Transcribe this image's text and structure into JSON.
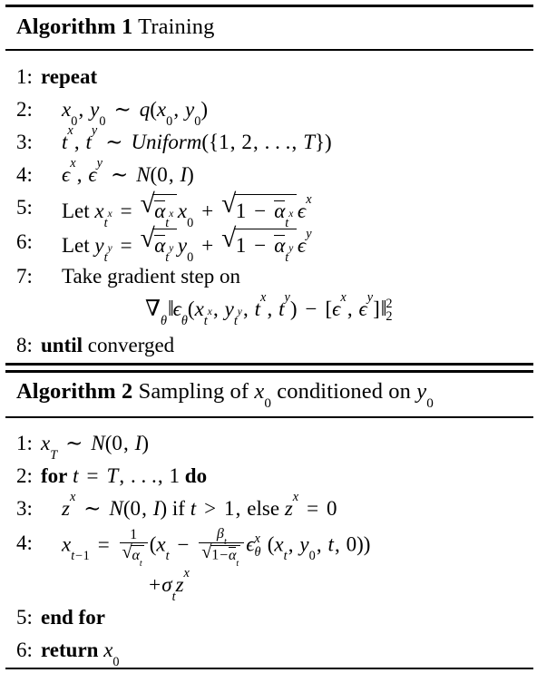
{
  "document": {
    "type": "algorithm-pseudocode-figure",
    "background_color": "#ffffff",
    "text_color": "#000000"
  },
  "algorithms": [
    {
      "id": "algorithm-1",
      "title_keyword": "Algorithm 1",
      "title_caption": "Training",
      "lines": [
        {
          "number": "1:",
          "indent": 0,
          "text": "repeat",
          "style": "keyword"
        },
        {
          "number": "2:",
          "indent": 1,
          "text": "x₀, y₀ ~ q(x₀, y₀)",
          "style": "math"
        },
        {
          "number": "3:",
          "indent": 1,
          "text": "t^x, t^y ~ Uniform({1, 2, …, T})",
          "style": "math"
        },
        {
          "number": "4:",
          "indent": 1,
          "text": "ϵ^x, ϵ^y ~ N(0, I)",
          "style": "math"
        },
        {
          "number": "5:",
          "indent": 1,
          "text": "Let x_{t^x} = √(ᾱ_{t^x}) x₀ + √(1 − ᾱ_{t^x}) ϵ^x",
          "style": "math"
        },
        {
          "number": "6:",
          "indent": 1,
          "text": "Let y_{t^y} = √(ᾱ_{t^y}) y₀ + √(1 − ᾱ_{t^y}) ϵ^y",
          "style": "math"
        },
        {
          "number": "7:",
          "indent": 1,
          "text": "Take gradient step on",
          "style": "text"
        },
        {
          "number": "",
          "indent": 2,
          "text": "∇_θ ‖ ϵ_θ(x_{t^x}, y_{t^y}, t^x, t^y) − [ϵ^x, ϵ^y] ‖²₂",
          "style": "math"
        },
        {
          "number": "8:",
          "indent": 0,
          "text": "until converged",
          "style": "keyword"
        }
      ]
    },
    {
      "id": "algorithm-2",
      "title_keyword": "Algorithm 2",
      "title_caption": "Sampling of x₀ conditioned on y₀",
      "lines": [
        {
          "number": "1:",
          "indent": 0,
          "text": "x_T ~ N(0, I)",
          "style": "math"
        },
        {
          "number": "2:",
          "indent": 0,
          "text": "for t = T, …, 1 do",
          "style": "keyword"
        },
        {
          "number": "3:",
          "indent": 1,
          "text": "z^x ~ N(0, I) if t > 1, else z^x = 0",
          "style": "math"
        },
        {
          "number": "4:",
          "indent": 1,
          "text": "x_{t−1} = 1/√(α_t) (x_t − β_t/√(1−ᾱ_t) ϵ^x_θ(x_t, y₀, t, 0))",
          "style": "math"
        },
        {
          "number": "",
          "indent": 2,
          "text": "+σ_t z^x",
          "style": "math"
        },
        {
          "number": "5:",
          "indent": 0,
          "text": "end for",
          "style": "keyword"
        },
        {
          "number": "6:",
          "indent": 0,
          "text": "return x₀",
          "style": "keyword"
        }
      ]
    }
  ],
  "symbols": {
    "tilde": "∼",
    "nabla": "∇",
    "theta": "θ",
    "epsilon": "ϵ",
    "alpha": "α",
    "beta": "β",
    "sigma": "σ",
    "radical": "√",
    "ellipsis": "…",
    "norm_bar": "‖"
  },
  "rules": {
    "algorithm1_top": "thick",
    "algorithm1_header": "thin",
    "algorithm1_bottom": "thick",
    "algorithm2_top": "thick",
    "algorithm2_header": "thin",
    "algorithm2_bottom": "thin"
  }
}
